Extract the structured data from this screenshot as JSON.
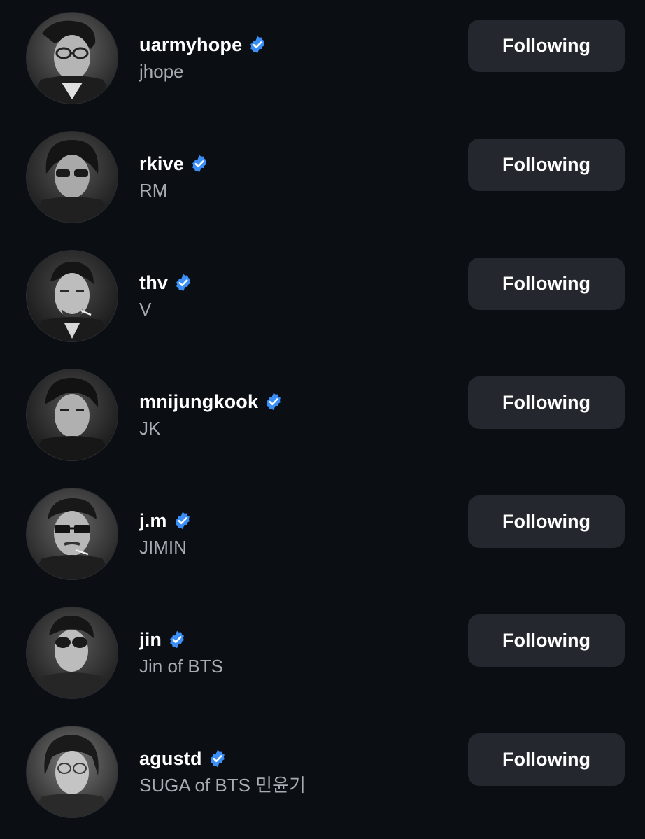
{
  "accent_color": "#3b8ff6",
  "users": [
    {
      "handle": "uarmyhope",
      "name": "jhope",
      "verified_icon": "verified-badge-icon",
      "button_label": "Following"
    },
    {
      "handle": "rkive",
      "name": "RM",
      "verified_icon": "verified-badge-icon",
      "button_label": "Following"
    },
    {
      "handle": "thv",
      "name": "V",
      "verified_icon": "verified-badge-icon",
      "button_label": "Following"
    },
    {
      "handle": "mnijungkook",
      "name": "JK",
      "verified_icon": "verified-badge-icon",
      "button_label": "Following"
    },
    {
      "handle": "j.m",
      "name": "JIMIN",
      "verified_icon": "verified-badge-icon",
      "button_label": "Following"
    },
    {
      "handle": "jin",
      "name": "Jin of BTS",
      "verified_icon": "verified-badge-icon",
      "button_label": "Following"
    },
    {
      "handle": "agustd",
      "name": "SUGA of BTS 민윤기",
      "verified_icon": "verified-badge-icon",
      "button_label": "Following"
    }
  ]
}
